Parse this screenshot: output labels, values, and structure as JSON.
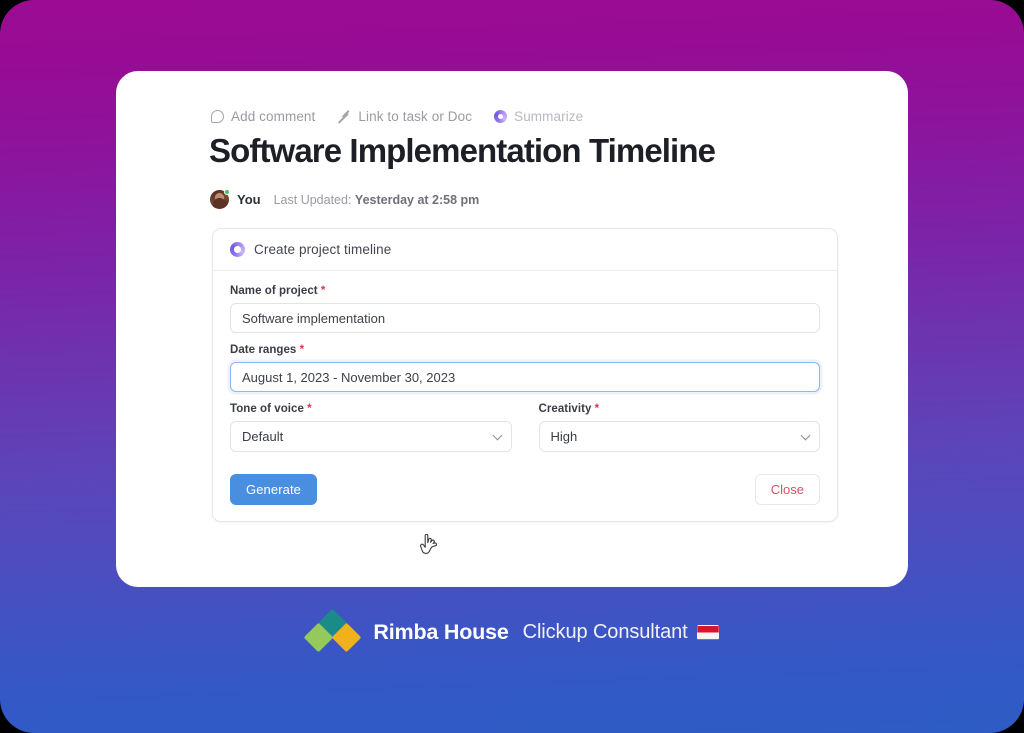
{
  "background": {
    "gradient_top": "#9c0b93",
    "gradient_mid": "#6a37b0",
    "gradient_bottom": "#2e5cc5"
  },
  "doc": {
    "toolbar": [
      {
        "icon": "comment-icon",
        "label": "Add comment"
      },
      {
        "icon": "link-icon",
        "label": "Link to task or Doc"
      },
      {
        "icon": "ai-sparkle-icon",
        "label": "Summarize"
      }
    ],
    "title": "Software Implementation Timeline",
    "byline": {
      "author": "You",
      "updated_prefix": "Last Updated:",
      "updated_value": "Yesterday at 2:58 pm"
    }
  },
  "ai_card": {
    "header_icon": "ai-sparkle-icon",
    "header_title": "Create project timeline",
    "fields": {
      "project_name": {
        "label": "Name of project",
        "required_marker": "*",
        "value": "Software implementation",
        "placeholder": "Name of project"
      },
      "date_ranges": {
        "label": "Date ranges",
        "required_marker": "*",
        "value": "August 1, 2023 - November 30, 2023",
        "placeholder": "Date ranges",
        "focused": true
      },
      "tone_of_voice": {
        "label": "Tone of voice",
        "required_marker": "*",
        "value": "Default"
      },
      "creativity": {
        "label": "Creativity",
        "required_marker": "*",
        "value": "High"
      }
    },
    "buttons": {
      "generate": "Generate",
      "close": "Close"
    },
    "colors": {
      "generate_bg": "#4a8ee0",
      "close_text": "#d35464",
      "focus_border": "#8fb6ee",
      "required_red": "#e0364c"
    }
  },
  "footer": {
    "brand": "Rimba House",
    "tagline": "Clickup Consultant",
    "flag": "indonesia-flag-icon",
    "logo_colors": {
      "teal": "#1a8b88",
      "green": "#95c95c",
      "gold": "#f0b11c"
    }
  }
}
